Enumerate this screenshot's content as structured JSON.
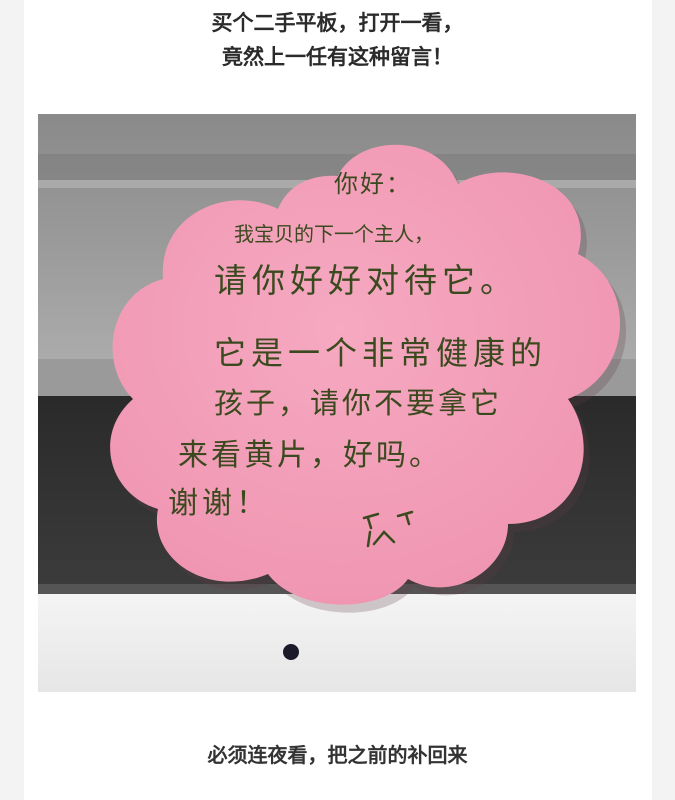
{
  "post": {
    "caption_top_line1": "买个二手平板，打开一看，",
    "caption_top_line2": "竟然上一任有这种留言！",
    "caption_bottom": "必须连夜看，把之前的补回来"
  },
  "note": {
    "greeting": "你好：",
    "line1": "我宝贝的下一个主人，",
    "line2": "请你好好对待它。",
    "line3": "它是一个非常健康的",
    "line4": "孩子，请你不要拿它",
    "line5": "来看黄片，好吗。",
    "line6": "谢谢！",
    "paper_color": "#f3a2bb",
    "ink_color": "#3b4a1e"
  }
}
